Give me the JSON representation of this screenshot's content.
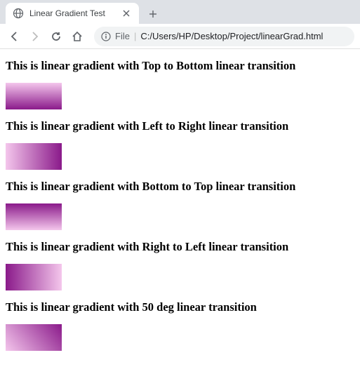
{
  "tab": {
    "title": "Linear Gradient Test"
  },
  "toolbar": {
    "file_label": "File",
    "url": "C:/Users/HP/Desktop/Project/linearGrad.html"
  },
  "sections": {
    "h1": "This is linear gradient with Top to Bottom linear transition",
    "h2": "This is linear gradient with Left to Right linear transition",
    "h3": "This is linear gradient with Bottom to Top linear transition",
    "h4": "This is linear gradient with Right to Left linear transition",
    "h5": "This is linear gradient with 50 deg linear transition"
  }
}
